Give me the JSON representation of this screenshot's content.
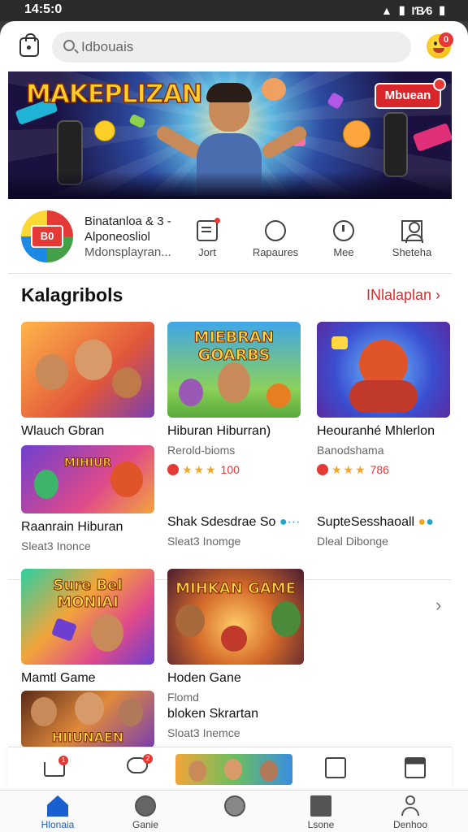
{
  "status_bar": {
    "time": "14:5:0",
    "right_text": "ƖƁ∕6"
  },
  "header": {
    "search_placeholder": "Idbouais",
    "notification_count": "0"
  },
  "hero": {
    "title": "MAKEPLIZAN",
    "button_label": "Mbuean"
  },
  "app_info": {
    "logo_text": "B0",
    "line1": "Binatanloa & 3 -",
    "line2": "Alponeosliol",
    "line3": "Mdonsplayran..."
  },
  "quick_actions": [
    {
      "label": "Jort",
      "icon": "note-icon"
    },
    {
      "label": "Rapaures",
      "icon": "search-icon"
    },
    {
      "label": "Mee",
      "icon": "clock-icon"
    },
    {
      "label": "Sheteha",
      "icon": "user-icon"
    }
  ],
  "section": {
    "title": "Kalagribols",
    "link_label": "INlalaplan ›"
  },
  "cards_row1": [
    {
      "title": "Wlauch Gbran",
      "image_label": ""
    },
    {
      "title": "Hiburan Hiburran)",
      "subtitle": "Rerold-bioms",
      "rating": "100",
      "image_label": "MIEBRAN GOARBS"
    },
    {
      "title": "Heouranhé Mhlerlon",
      "subtitle": "Banodshama",
      "rating": "786",
      "image_label": ""
    }
  ],
  "cards_row2": [
    {
      "title": "Raanrain Hiburan",
      "subtitle": "Sleat3 Inonce",
      "image_label": "MIHIUR"
    },
    {
      "title": "Shak Sdesdrae So",
      "subtitle": "Sleat3 Inomge"
    },
    {
      "title": "SupteSesshaoall",
      "subtitle": "Dleal Dibonge"
    }
  ],
  "cards_row3": [
    {
      "title": "Mamtl Game",
      "image_label": "Sure Bel MONIAI"
    },
    {
      "title": "Hoden Gane",
      "subtitle": "Flomd",
      "image_label": "MIHKAN GAME"
    }
  ],
  "cards_row4": [
    {
      "title": "",
      "image_label": "HIIUNAEN"
    },
    {
      "title": "bloken Skrartan",
      "subtitle": "Sloat3 Inemce"
    }
  ],
  "bottom_strip": {
    "badge1": "1",
    "badge2": "2"
  },
  "navbar": [
    {
      "label": "Hlonaia",
      "icon": "home-icon",
      "active": true
    },
    {
      "label": "Ganie",
      "icon": "search-icon",
      "active": false
    },
    {
      "label": "",
      "icon": "compass-icon",
      "active": false
    },
    {
      "label": "Lsone",
      "icon": "bookmark-icon",
      "active": false
    },
    {
      "label": "Denhoo",
      "icon": "profile-icon",
      "active": false
    }
  ],
  "colors": {
    "accent_red": "#d32f2f",
    "nav_active": "#1a5fd0",
    "star": "#f5a623"
  }
}
